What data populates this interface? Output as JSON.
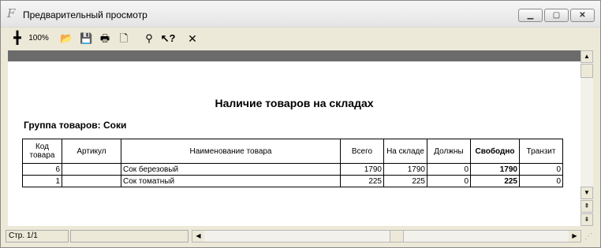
{
  "window": {
    "title": "Предварительный просмотр"
  },
  "toolbar": {
    "zoom_label": "100%"
  },
  "report": {
    "title": "Наличие товаров на складах",
    "group_label": "Группа товаров: Соки",
    "columns": [
      "Код товара",
      "Артикул",
      "Наименование товара",
      "Всего",
      "На складе",
      "Должны",
      "Свободно",
      "Транзит"
    ],
    "rows": [
      {
        "code": "6",
        "article": "",
        "name": "Сок березовый",
        "total": "1790",
        "in_stock": "1790",
        "owed": "0",
        "free": "1790",
        "transit": "0"
      },
      {
        "code": "1",
        "article": "",
        "name": "Сок томатный",
        "total": "225",
        "in_stock": "225",
        "owed": "0",
        "free": "225",
        "transit": "0"
      }
    ]
  },
  "status": {
    "page_info": "Стр. 1/1"
  }
}
